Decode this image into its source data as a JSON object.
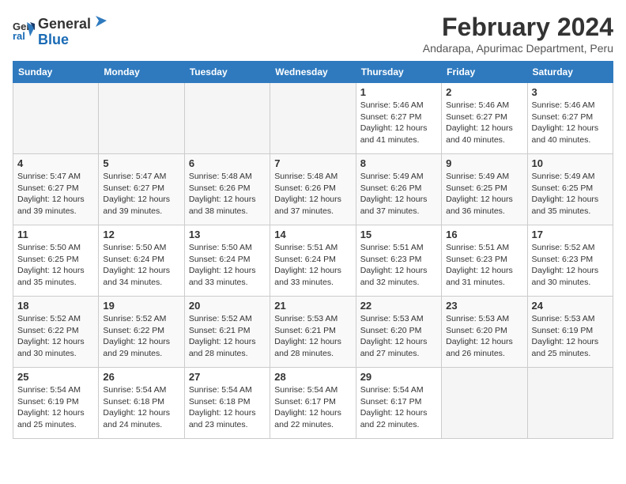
{
  "logo": {
    "line1": "General",
    "line2": "Blue"
  },
  "title": "February 2024",
  "location": "Andarapa, Apurimac Department, Peru",
  "days_of_week": [
    "Sunday",
    "Monday",
    "Tuesday",
    "Wednesday",
    "Thursday",
    "Friday",
    "Saturday"
  ],
  "weeks": [
    [
      {
        "day": "",
        "detail": ""
      },
      {
        "day": "",
        "detail": ""
      },
      {
        "day": "",
        "detail": ""
      },
      {
        "day": "",
        "detail": ""
      },
      {
        "day": "1",
        "detail": "Sunrise: 5:46 AM\nSunset: 6:27 PM\nDaylight: 12 hours\nand 41 minutes."
      },
      {
        "day": "2",
        "detail": "Sunrise: 5:46 AM\nSunset: 6:27 PM\nDaylight: 12 hours\nand 40 minutes."
      },
      {
        "day": "3",
        "detail": "Sunrise: 5:46 AM\nSunset: 6:27 PM\nDaylight: 12 hours\nand 40 minutes."
      }
    ],
    [
      {
        "day": "4",
        "detail": "Sunrise: 5:47 AM\nSunset: 6:27 PM\nDaylight: 12 hours\nand 39 minutes."
      },
      {
        "day": "5",
        "detail": "Sunrise: 5:47 AM\nSunset: 6:27 PM\nDaylight: 12 hours\nand 39 minutes."
      },
      {
        "day": "6",
        "detail": "Sunrise: 5:48 AM\nSunset: 6:26 PM\nDaylight: 12 hours\nand 38 minutes."
      },
      {
        "day": "7",
        "detail": "Sunrise: 5:48 AM\nSunset: 6:26 PM\nDaylight: 12 hours\nand 37 minutes."
      },
      {
        "day": "8",
        "detail": "Sunrise: 5:49 AM\nSunset: 6:26 PM\nDaylight: 12 hours\nand 37 minutes."
      },
      {
        "day": "9",
        "detail": "Sunrise: 5:49 AM\nSunset: 6:25 PM\nDaylight: 12 hours\nand 36 minutes."
      },
      {
        "day": "10",
        "detail": "Sunrise: 5:49 AM\nSunset: 6:25 PM\nDaylight: 12 hours\nand 35 minutes."
      }
    ],
    [
      {
        "day": "11",
        "detail": "Sunrise: 5:50 AM\nSunset: 6:25 PM\nDaylight: 12 hours\nand 35 minutes."
      },
      {
        "day": "12",
        "detail": "Sunrise: 5:50 AM\nSunset: 6:24 PM\nDaylight: 12 hours\nand 34 minutes."
      },
      {
        "day": "13",
        "detail": "Sunrise: 5:50 AM\nSunset: 6:24 PM\nDaylight: 12 hours\nand 33 minutes."
      },
      {
        "day": "14",
        "detail": "Sunrise: 5:51 AM\nSunset: 6:24 PM\nDaylight: 12 hours\nand 33 minutes."
      },
      {
        "day": "15",
        "detail": "Sunrise: 5:51 AM\nSunset: 6:23 PM\nDaylight: 12 hours\nand 32 minutes."
      },
      {
        "day": "16",
        "detail": "Sunrise: 5:51 AM\nSunset: 6:23 PM\nDaylight: 12 hours\nand 31 minutes."
      },
      {
        "day": "17",
        "detail": "Sunrise: 5:52 AM\nSunset: 6:23 PM\nDaylight: 12 hours\nand 30 minutes."
      }
    ],
    [
      {
        "day": "18",
        "detail": "Sunrise: 5:52 AM\nSunset: 6:22 PM\nDaylight: 12 hours\nand 30 minutes."
      },
      {
        "day": "19",
        "detail": "Sunrise: 5:52 AM\nSunset: 6:22 PM\nDaylight: 12 hours\nand 29 minutes."
      },
      {
        "day": "20",
        "detail": "Sunrise: 5:52 AM\nSunset: 6:21 PM\nDaylight: 12 hours\nand 28 minutes."
      },
      {
        "day": "21",
        "detail": "Sunrise: 5:53 AM\nSunset: 6:21 PM\nDaylight: 12 hours\nand 28 minutes."
      },
      {
        "day": "22",
        "detail": "Sunrise: 5:53 AM\nSunset: 6:20 PM\nDaylight: 12 hours\nand 27 minutes."
      },
      {
        "day": "23",
        "detail": "Sunrise: 5:53 AM\nSunset: 6:20 PM\nDaylight: 12 hours\nand 26 minutes."
      },
      {
        "day": "24",
        "detail": "Sunrise: 5:53 AM\nSunset: 6:19 PM\nDaylight: 12 hours\nand 25 minutes."
      }
    ],
    [
      {
        "day": "25",
        "detail": "Sunrise: 5:54 AM\nSunset: 6:19 PM\nDaylight: 12 hours\nand 25 minutes."
      },
      {
        "day": "26",
        "detail": "Sunrise: 5:54 AM\nSunset: 6:18 PM\nDaylight: 12 hours\nand 24 minutes."
      },
      {
        "day": "27",
        "detail": "Sunrise: 5:54 AM\nSunset: 6:18 PM\nDaylight: 12 hours\nand 23 minutes."
      },
      {
        "day": "28",
        "detail": "Sunrise: 5:54 AM\nSunset: 6:17 PM\nDaylight: 12 hours\nand 22 minutes."
      },
      {
        "day": "29",
        "detail": "Sunrise: 5:54 AM\nSunset: 6:17 PM\nDaylight: 12 hours\nand 22 minutes."
      },
      {
        "day": "",
        "detail": ""
      },
      {
        "day": "",
        "detail": ""
      }
    ]
  ]
}
